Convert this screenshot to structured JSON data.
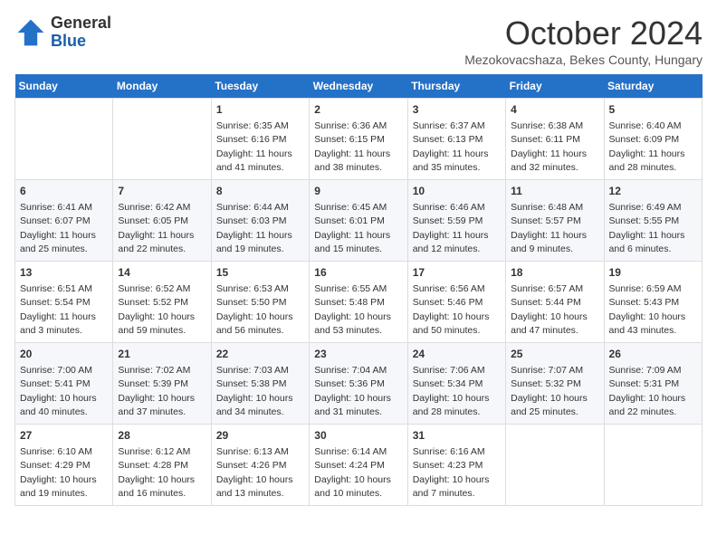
{
  "logo": {
    "general": "General",
    "blue": "Blue"
  },
  "header": {
    "month": "October 2024",
    "location": "Mezokovacshaza, Bekes County, Hungary"
  },
  "weekdays": [
    "Sunday",
    "Monday",
    "Tuesday",
    "Wednesday",
    "Thursday",
    "Friday",
    "Saturday"
  ],
  "weeks": [
    [
      {
        "day": "",
        "info": ""
      },
      {
        "day": "",
        "info": ""
      },
      {
        "day": "1",
        "info": "Sunrise: 6:35 AM\nSunset: 6:16 PM\nDaylight: 11 hours and 41 minutes."
      },
      {
        "day": "2",
        "info": "Sunrise: 6:36 AM\nSunset: 6:15 PM\nDaylight: 11 hours and 38 minutes."
      },
      {
        "day": "3",
        "info": "Sunrise: 6:37 AM\nSunset: 6:13 PM\nDaylight: 11 hours and 35 minutes."
      },
      {
        "day": "4",
        "info": "Sunrise: 6:38 AM\nSunset: 6:11 PM\nDaylight: 11 hours and 32 minutes."
      },
      {
        "day": "5",
        "info": "Sunrise: 6:40 AM\nSunset: 6:09 PM\nDaylight: 11 hours and 28 minutes."
      }
    ],
    [
      {
        "day": "6",
        "info": "Sunrise: 6:41 AM\nSunset: 6:07 PM\nDaylight: 11 hours and 25 minutes."
      },
      {
        "day": "7",
        "info": "Sunrise: 6:42 AM\nSunset: 6:05 PM\nDaylight: 11 hours and 22 minutes."
      },
      {
        "day": "8",
        "info": "Sunrise: 6:44 AM\nSunset: 6:03 PM\nDaylight: 11 hours and 19 minutes."
      },
      {
        "day": "9",
        "info": "Sunrise: 6:45 AM\nSunset: 6:01 PM\nDaylight: 11 hours and 15 minutes."
      },
      {
        "day": "10",
        "info": "Sunrise: 6:46 AM\nSunset: 5:59 PM\nDaylight: 11 hours and 12 minutes."
      },
      {
        "day": "11",
        "info": "Sunrise: 6:48 AM\nSunset: 5:57 PM\nDaylight: 11 hours and 9 minutes."
      },
      {
        "day": "12",
        "info": "Sunrise: 6:49 AM\nSunset: 5:55 PM\nDaylight: 11 hours and 6 minutes."
      }
    ],
    [
      {
        "day": "13",
        "info": "Sunrise: 6:51 AM\nSunset: 5:54 PM\nDaylight: 11 hours and 3 minutes."
      },
      {
        "day": "14",
        "info": "Sunrise: 6:52 AM\nSunset: 5:52 PM\nDaylight: 10 hours and 59 minutes."
      },
      {
        "day": "15",
        "info": "Sunrise: 6:53 AM\nSunset: 5:50 PM\nDaylight: 10 hours and 56 minutes."
      },
      {
        "day": "16",
        "info": "Sunrise: 6:55 AM\nSunset: 5:48 PM\nDaylight: 10 hours and 53 minutes."
      },
      {
        "day": "17",
        "info": "Sunrise: 6:56 AM\nSunset: 5:46 PM\nDaylight: 10 hours and 50 minutes."
      },
      {
        "day": "18",
        "info": "Sunrise: 6:57 AM\nSunset: 5:44 PM\nDaylight: 10 hours and 47 minutes."
      },
      {
        "day": "19",
        "info": "Sunrise: 6:59 AM\nSunset: 5:43 PM\nDaylight: 10 hours and 43 minutes."
      }
    ],
    [
      {
        "day": "20",
        "info": "Sunrise: 7:00 AM\nSunset: 5:41 PM\nDaylight: 10 hours and 40 minutes."
      },
      {
        "day": "21",
        "info": "Sunrise: 7:02 AM\nSunset: 5:39 PM\nDaylight: 10 hours and 37 minutes."
      },
      {
        "day": "22",
        "info": "Sunrise: 7:03 AM\nSunset: 5:38 PM\nDaylight: 10 hours and 34 minutes."
      },
      {
        "day": "23",
        "info": "Sunrise: 7:04 AM\nSunset: 5:36 PM\nDaylight: 10 hours and 31 minutes."
      },
      {
        "day": "24",
        "info": "Sunrise: 7:06 AM\nSunset: 5:34 PM\nDaylight: 10 hours and 28 minutes."
      },
      {
        "day": "25",
        "info": "Sunrise: 7:07 AM\nSunset: 5:32 PM\nDaylight: 10 hours and 25 minutes."
      },
      {
        "day": "26",
        "info": "Sunrise: 7:09 AM\nSunset: 5:31 PM\nDaylight: 10 hours and 22 minutes."
      }
    ],
    [
      {
        "day": "27",
        "info": "Sunrise: 6:10 AM\nSunset: 4:29 PM\nDaylight: 10 hours and 19 minutes."
      },
      {
        "day": "28",
        "info": "Sunrise: 6:12 AM\nSunset: 4:28 PM\nDaylight: 10 hours and 16 minutes."
      },
      {
        "day": "29",
        "info": "Sunrise: 6:13 AM\nSunset: 4:26 PM\nDaylight: 10 hours and 13 minutes."
      },
      {
        "day": "30",
        "info": "Sunrise: 6:14 AM\nSunset: 4:24 PM\nDaylight: 10 hours and 10 minutes."
      },
      {
        "day": "31",
        "info": "Sunrise: 6:16 AM\nSunset: 4:23 PM\nDaylight: 10 hours and 7 minutes."
      },
      {
        "day": "",
        "info": ""
      },
      {
        "day": "",
        "info": ""
      }
    ]
  ]
}
